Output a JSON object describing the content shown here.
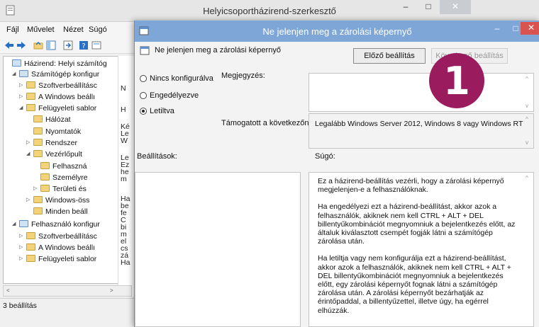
{
  "gpe": {
    "title": "Helyicsoportházirend-szerkesztő",
    "menus": [
      "Fájl",
      "Művelet",
      "Nézet",
      "Súgó"
    ],
    "tree": [
      {
        "label": "Házirend: Helyi számítóg",
        "indent": 0
      },
      {
        "label": "Számítógép konfigur",
        "indent": 1
      },
      {
        "label": "Szoftverbeállításc",
        "indent": 2
      },
      {
        "label": "A Windows beállı",
        "indent": 2
      },
      {
        "label": "Felügyeleti sablor",
        "indent": 2
      },
      {
        "label": "Hálózat",
        "indent": 3
      },
      {
        "label": "Nyomtatók",
        "indent": 3
      },
      {
        "label": "Rendszer",
        "indent": 3
      },
      {
        "label": "Vezérlőpult",
        "indent": 3
      },
      {
        "label": "Felhaszná",
        "indent": 4
      },
      {
        "label": "Személyre",
        "indent": 4
      },
      {
        "label": "Területi és",
        "indent": 4
      },
      {
        "label": "Windows-öss",
        "indent": 3
      },
      {
        "label": "Minden beáll",
        "indent": 3
      },
      {
        "label": "Felhasználó konfigur",
        "indent": 1
      },
      {
        "label": "Szoftverbeállításc",
        "indent": 2
      },
      {
        "label": "A Windows beállı",
        "indent": 2
      },
      {
        "label": "Felügyeleti sablor",
        "indent": 2
      }
    ],
    "mid_fragments": [
      "N",
      "H",
      "Ké",
      "Le",
      "W",
      "Le",
      "Ez",
      "he",
      "m",
      "Ha",
      "be",
      "fe",
      "C",
      "bi",
      "m",
      "el",
      "cs",
      "zá",
      "Ha"
    ],
    "status": "3 beállítás"
  },
  "dialog": {
    "title": "Ne jelenjen meg a zárolási képernyő",
    "policy_name": "Ne jelenjen meg a zárolási képernyő",
    "prev_button": "Előző beállítás",
    "next_button": "Következő beállítás",
    "radios": [
      {
        "label": "Nincs konfigurálva",
        "selected": false
      },
      {
        "label": "Engedélyezve",
        "selected": false
      },
      {
        "label": "Letiltva",
        "selected": true
      }
    ],
    "note_label": "Megjegyzés:",
    "supported_label": "Támogatott a következőn:",
    "supported_value": "Legalább Windows Server 2012,  Windows 8 vagy Windows RT",
    "options_label": "Beállítások:",
    "help_label": "Súgó:",
    "help_paragraphs": [
      "Ez a házirend-beállítás vezérli, hogy a zárolási képernyő megjelenjen-e a felhasználóknak.",
      "Ha engedélyezi ezt a házirend-beállítást, akkor azok a felhasználók, akiknek nem kell CTRL + ALT + DEL billentyűkombinációt megnyomniuk a bejelentkezés előtt, az általuk kiválasztott csempét fogják látni a számítógép zárolása után.",
      "Ha letiltja vagy nem konfigurálja ezt a házirend-beállítást, akkor azok a felhasználók, akiknek nem kell CTRL + ALT + DEL billentyűkombinációt megnyomniuk a bejelentkezés előtt, egy zárolási képernyőt fognak látni a számítógép zárolása után. A zárolási képernyőt bezárhatják az érintőpaddal, a billentyűzettel, illetve úgy, ha egérrel elhúzzák."
    ]
  },
  "badge": {
    "number": "1",
    "color": "#9a1b5e"
  }
}
